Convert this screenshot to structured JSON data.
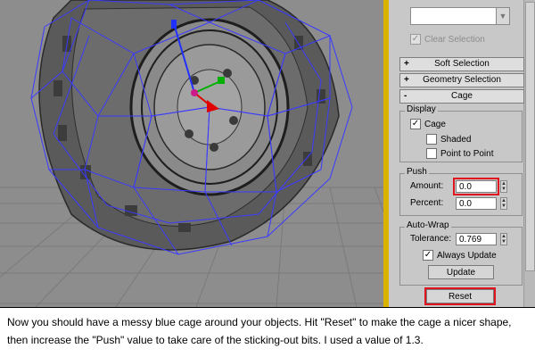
{
  "panel": {
    "clear_selection": "Clear Selection",
    "rollouts": {
      "soft_selection": "Soft Selection",
      "geometry_selection": "Geometry Selection",
      "cage": "Cage",
      "plus_sign": "+",
      "minus_sign": "-"
    },
    "display": {
      "group_label": "Display",
      "cage_label": "Cage",
      "cage_checked": true,
      "shaded_label": "Shaded",
      "shaded_checked": false,
      "point_to_point_label": "Point to Point",
      "point_to_point_checked": false
    },
    "push": {
      "group_label": "Push",
      "amount_label": "Amount:",
      "amount_value": "0.0",
      "percent_label": "Percent:",
      "percent_value": "0.0"
    },
    "auto_wrap": {
      "group_label": "Auto-Wrap",
      "tolerance_label": "Tolerance:",
      "tolerance_value": "0.769",
      "always_update_label": "Always Update",
      "always_update_checked": true,
      "update_button": "Update"
    },
    "reset_button": "Reset",
    "highlight_color": "#e0141e",
    "accent_edge_color": "#d9b300"
  },
  "viewport": {
    "background_color": "#8d8d8d",
    "cage_color": "#3a3aff",
    "gizmo_x_color": "#e00000",
    "gizmo_y_color": "#00b000",
    "gizmo_z_color": "#2030ff"
  },
  "caption": {
    "text": "Now you should have a messy blue cage around your objects. Hit \"Reset\" to make the cage a nicer shape, then increase the \"Push\" value to take care of the sticking-out bits. I used a value of 1.3."
  }
}
